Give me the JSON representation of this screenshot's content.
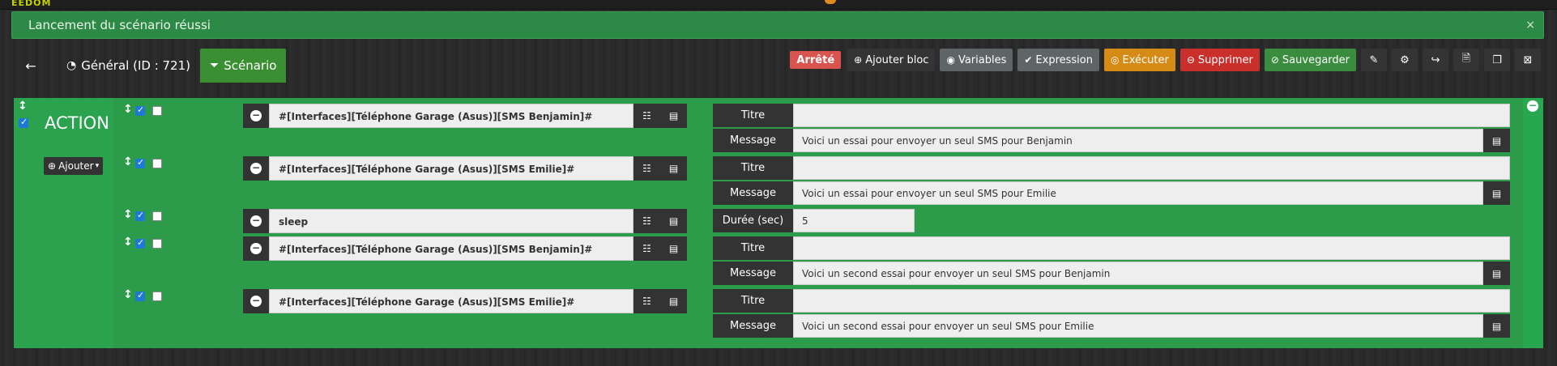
{
  "topbar": {
    "logo": "EEDOM"
  },
  "alert": {
    "message": "Lancement du scénario réussi",
    "close": "×"
  },
  "nav": {
    "back_icon": "←",
    "tabs": [
      {
        "icon": "◔",
        "label": "Général (ID : 721)"
      },
      {
        "icon": "⏷",
        "label": "Scénario"
      }
    ]
  },
  "toolbar": {
    "status": "Arrêté",
    "buttons": [
      {
        "icon": "⊕",
        "label": "Ajouter bloc"
      },
      {
        "icon": "◉",
        "label": "Variables"
      },
      {
        "icon": "✔",
        "label": "Expression"
      },
      {
        "icon": "◎",
        "label": "Exécuter"
      },
      {
        "icon": "⊖",
        "label": "Supprimer"
      },
      {
        "icon": "⊘",
        "label": "Sauvegarder"
      }
    ],
    "icon_buttons": [
      "✎",
      "⚙",
      "↪",
      "🗎",
      "❐",
      "⊠"
    ]
  },
  "action": {
    "title": "ACTION",
    "add_label": "Ajouter",
    "commands": [
      {
        "command": "#[Interfaces][Téléphone Garage (Asus)][SMS Benjamin]#",
        "options": [
          {
            "label": "Titre",
            "value": ""
          },
          {
            "label": "Message",
            "value": "Voici un essai pour envoyer un seul SMS pour Benjamin"
          }
        ]
      },
      {
        "command": "#[Interfaces][Téléphone Garage (Asus)][SMS Emilie]#",
        "options": [
          {
            "label": "Titre",
            "value": ""
          },
          {
            "label": "Message",
            "value": "Voici un essai pour envoyer un seul SMS pour Emilie"
          }
        ]
      },
      {
        "command": "sleep",
        "options": [
          {
            "label": "Durée (sec)",
            "value": "5"
          }
        ]
      },
      {
        "command": "#[Interfaces][Téléphone Garage (Asus)][SMS Benjamin]#",
        "options": [
          {
            "label": "Titre",
            "value": ""
          },
          {
            "label": "Message",
            "value": "Voici un second essai pour envoyer un seul SMS pour Benjamin"
          }
        ]
      },
      {
        "command": "#[Interfaces][Téléphone Garage (Asus)][SMS Emilie]#",
        "options": [
          {
            "label": "Titre",
            "value": ""
          },
          {
            "label": "Message",
            "value": "Voici un second essai pour envoyer un seul SMS pour Emilie"
          }
        ]
      }
    ]
  },
  "colors": {
    "alert_bg": "#2d8a46",
    "action_bg": "#27a850",
    "status_red": "#d9534f",
    "execute_orange": "#d68b16",
    "delete_red": "#c9302c",
    "save_green": "#3a8d3f"
  }
}
